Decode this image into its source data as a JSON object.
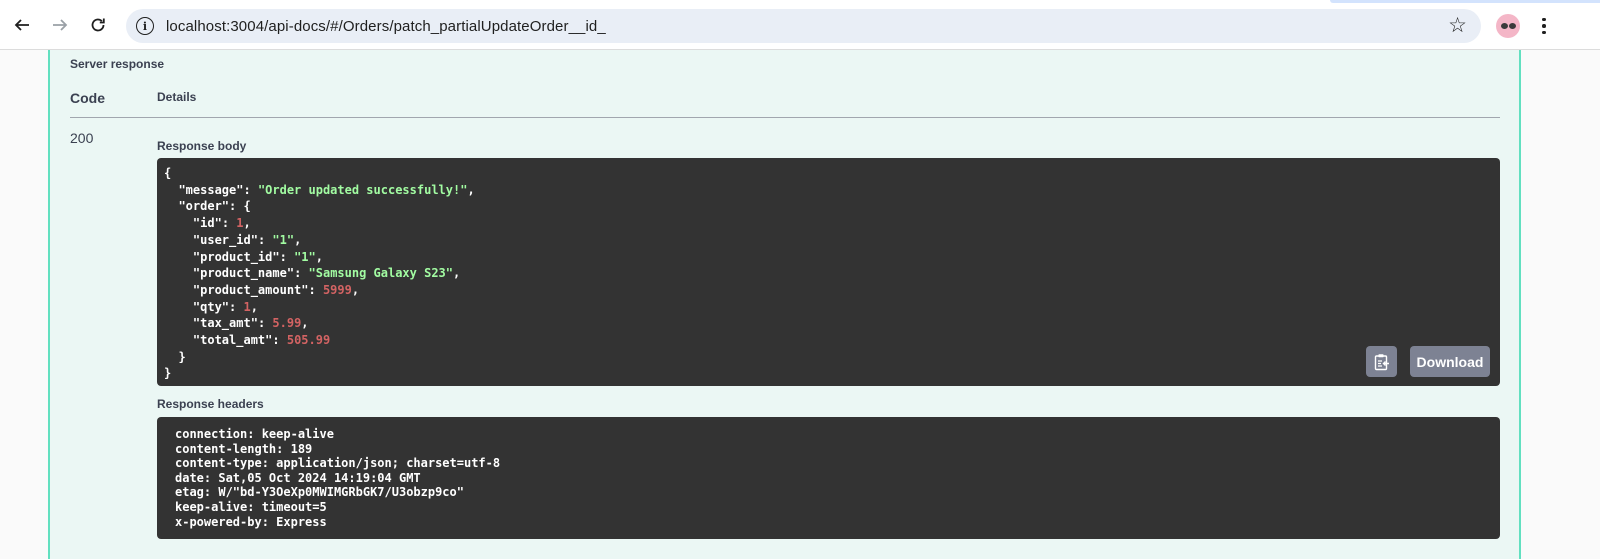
{
  "browser": {
    "url": "localhost:3004/api-docs/#/Orders/patch_partialUpdateOrder__id_",
    "back_icon": "arrow-left-icon",
    "forward_icon": "arrow-right-icon",
    "reload_icon": "reload-icon",
    "site_info_icon": "info-icon",
    "bookmark_icon": "star-icon",
    "menu_icon": "kebab-menu-icon"
  },
  "response": {
    "section_title": "Server response",
    "columns": {
      "code": "Code",
      "details": "Details"
    },
    "code": "200",
    "body_label": "Response body",
    "body": {
      "open": "{",
      "message_key": "\"message\"",
      "message_value": "\"Order updated successfully!\"",
      "order_key": "\"order\"",
      "order_fields": [
        {
          "key": "\"id\"",
          "value": "1",
          "type": "number"
        },
        {
          "key": "\"user_id\"",
          "value": "\"1\"",
          "type": "string"
        },
        {
          "key": "\"product_id\"",
          "value": "\"1\"",
          "type": "string"
        },
        {
          "key": "\"product_name\"",
          "value": "\"Samsung Galaxy S23\"",
          "type": "string"
        },
        {
          "key": "\"product_amount\"",
          "value": "5999",
          "type": "number"
        },
        {
          "key": "\"qty\"",
          "value": "1",
          "type": "number"
        },
        {
          "key": "\"tax_amt\"",
          "value": "5.99",
          "type": "number"
        },
        {
          "key": "\"total_amt\"",
          "value": "505.99",
          "type": "number"
        }
      ],
      "close_inner": "}",
      "close": "}"
    },
    "copy_icon": "clipboard-copy-icon",
    "download_label": "Download",
    "headers_label": "Response headers",
    "headers": [
      "connection: keep-alive",
      "content-length: 189",
      "content-type: application/json; charset=utf-8",
      "date: Sat,05 Oct 2024 14:19:04 GMT",
      "etag: W/\"bd-Y3OeXp0MWIMGRbGK7/U3obzp9co\"",
      "keep-alive: timeout=5",
      "x-powered-by: Express"
    ]
  },
  "colors": {
    "json_string": "#a2fca2",
    "json_number": "#d36363",
    "opblock_bg": "#ebf7f4",
    "opblock_border": "#62e0c0",
    "code_bg": "#333333",
    "button_bg": "#7d8293"
  }
}
